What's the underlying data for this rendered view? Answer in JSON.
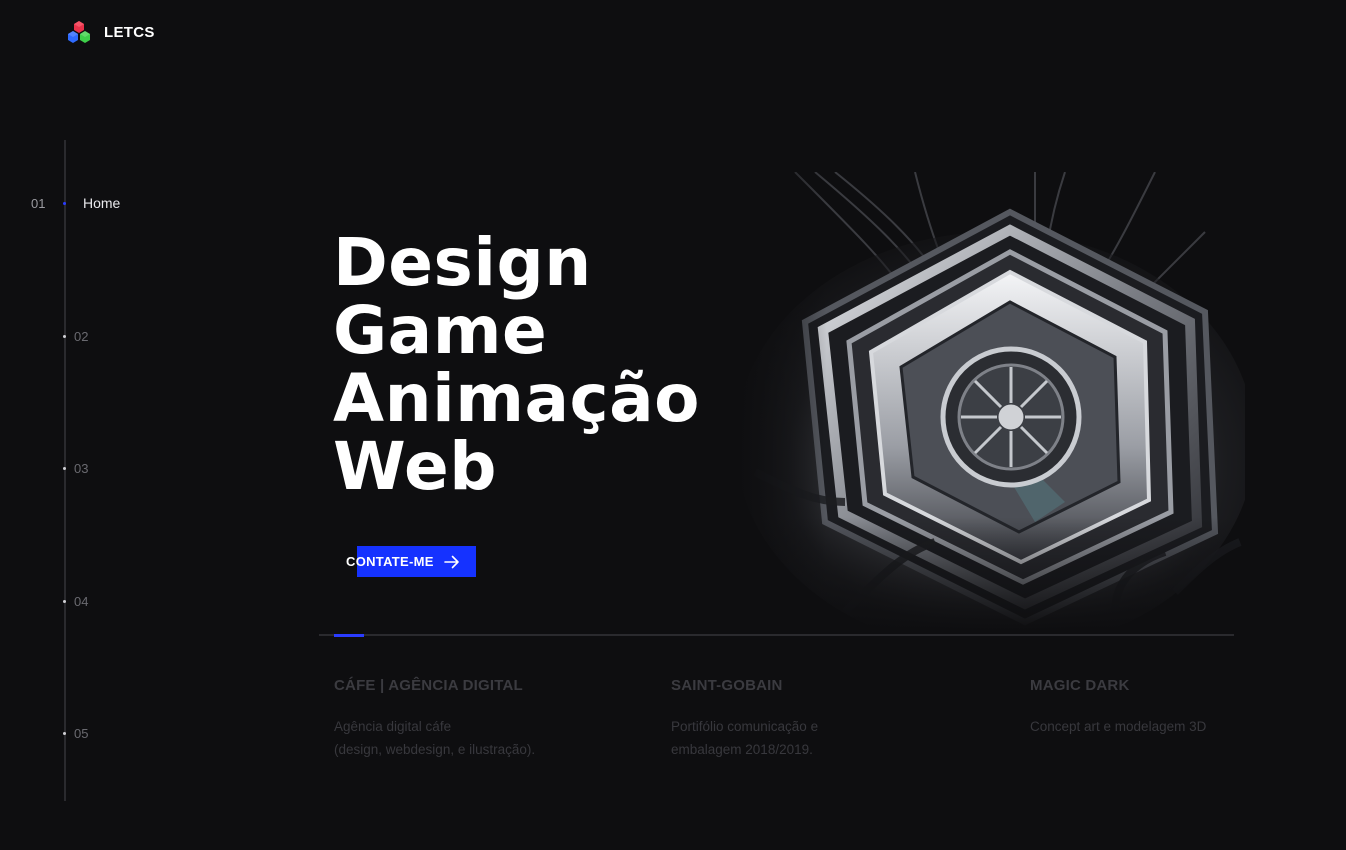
{
  "header": {
    "logo_text": "LETCS",
    "logo_colors": [
      "#e8324a",
      "#2f6bff",
      "#3ecf4a"
    ]
  },
  "side_nav": {
    "items": [
      {
        "number": "01",
        "label": "Home",
        "active": true
      },
      {
        "number": "02",
        "label": "",
        "active": false
      },
      {
        "number": "03",
        "label": "",
        "active": false
      },
      {
        "number": "04",
        "label": "",
        "active": false
      },
      {
        "number": "05",
        "label": "",
        "active": false
      }
    ]
  },
  "hero": {
    "lines": [
      "Design",
      "Game",
      "Animação",
      "Web"
    ],
    "cta_label": "CONTATE-ME",
    "cta_icon": "arrow-right-icon"
  },
  "slider": {
    "progress": 0.033
  },
  "projects": [
    {
      "title": "CÁFE | AGÊNCIA DIGITAL",
      "desc_lines": [
        "Agência digital cáfe",
        "(design, webdesign, e ilustração)."
      ]
    },
    {
      "title": "SAINT-GOBAIN",
      "desc_lines": [
        "Portifólio comunicação e",
        "embalagem 2018/2019."
      ]
    },
    {
      "title": "MAGIC DARK",
      "desc_lines": [
        "Concept art e modelagem 3D"
      ]
    }
  ],
  "colors": {
    "background": "#0e0e10",
    "accent": "#1532ff",
    "muted_text": "#38383d"
  }
}
